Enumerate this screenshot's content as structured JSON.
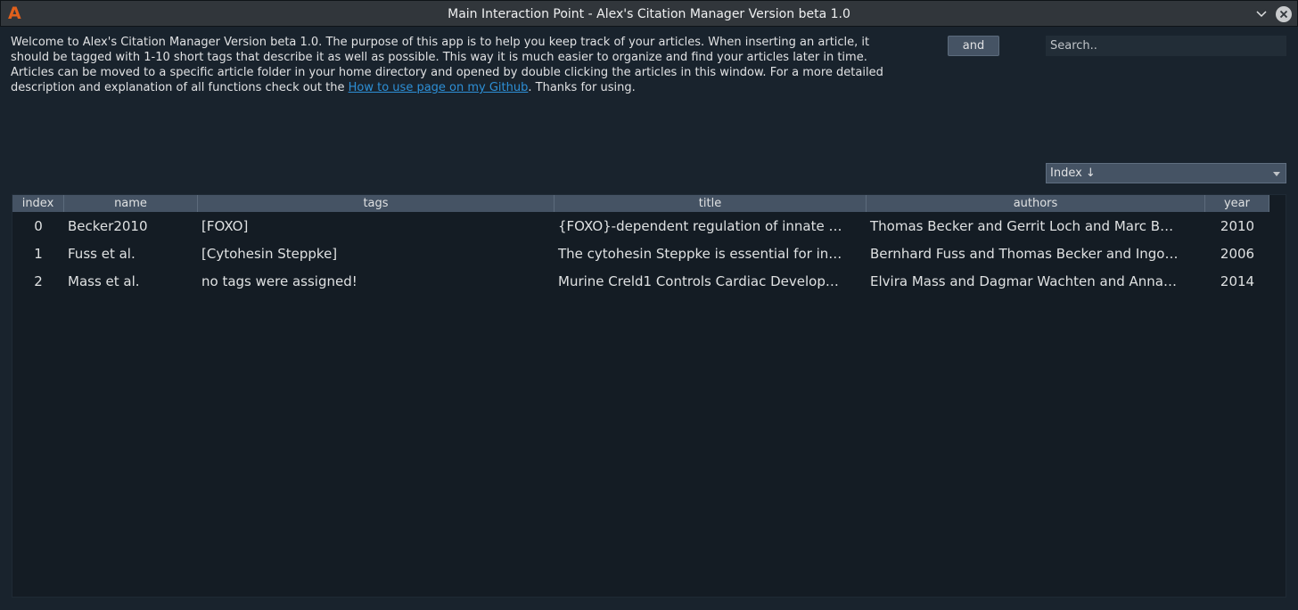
{
  "window": {
    "title": "Main Interaction Point - Alex's Citation Manager Version beta 1.0",
    "logo_letter": "A"
  },
  "intro": {
    "text_before_link": "Welcome to Alex's Citation Manager Version beta 1.0. The purpose of this app is to help you keep track of your articles. When inserting an article, it should be tagged with 1-10 short tags that describe it as well as possible. This way it is much easier to organize and find your articles later in time. Articles can be moved to a specific article folder in your home directory and opened by double clicking the articles in this window. For a more detailed description and explanation of all functions check out the ",
    "link_text": "How to use page on my Github",
    "text_after_link": ". Thanks for using."
  },
  "controls": {
    "and_label": "and",
    "search_placeholder": "Search..",
    "sort_value": "Index ↓"
  },
  "table": {
    "columns": [
      "index",
      "name",
      "tags",
      "title",
      "authors",
      "year"
    ],
    "rows": [
      {
        "index": "0",
        "name": "Becker2010",
        "tags": "[FOXO]",
        "title": "{FOXO}-dependent regulation of innate …",
        "authors": "Thomas Becker and Gerrit Loch and Marc B…",
        "year": "2010"
      },
      {
        "index": "1",
        "name": "Fuss et al.",
        "tags": "[Cytohesin Steppke]",
        "title": "The cytohesin Steppke is essential for in…",
        "authors": "Bernhard Fuss and Thomas Becker and Ingo…",
        "year": "2006"
      },
      {
        "index": "2",
        "name": "Mass et al.",
        "tags": "no tags were assigned!",
        "title": "Murine Creld1 Controls Cardiac Develop…",
        "authors": "Elvira Mass and Dagmar Wachten and Anna…",
        "year": "2014"
      }
    ]
  }
}
